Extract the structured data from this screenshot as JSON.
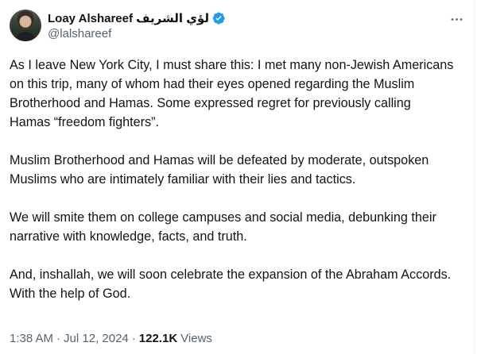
{
  "author": {
    "display_name": "Loay Alshareef لؤي الشريف",
    "handle": "@lalshareef",
    "verified": true,
    "verified_color": "#1d9bf0"
  },
  "tweet": {
    "paragraphs": [
      "As I leave New York City, I must share this: I met many non-Jewish Americans on this trip, many of whom had their eyes opened regarding the Muslim Brotherhood and Hamas. Some expressed regret for previously calling Hamas “freedom fighters”.",
      "Muslim Brotherhood and Hamas will be defeated by moderate, outspoken Muslims who are intimately familiar with their lies and tactics.",
      "We will smite them on college campuses and social media, debunking their narrative with knowledge, facts, and truth.",
      "And, inshallah, we will soon celebrate the expansion of the Abraham Accords. With the help of God."
    ]
  },
  "meta": {
    "time": "1:38 AM",
    "separator": "·",
    "date": "Jul 12, 2024",
    "views_count": "122.1K",
    "views_label": "Views"
  },
  "icons": {
    "more": "more-horizontal-icon",
    "verified": "verified-badge-icon"
  }
}
